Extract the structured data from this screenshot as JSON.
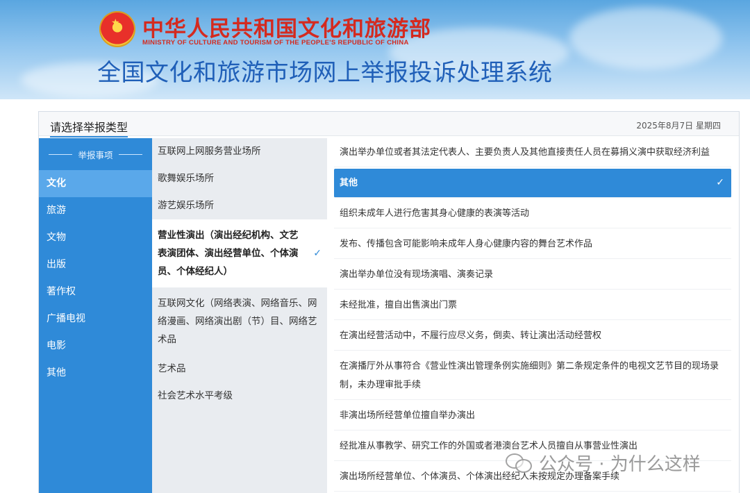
{
  "header": {
    "ministry_cn": "中华人民共和国文化和旅游部",
    "ministry_en": "MINISTRY OF CULTURE AND TOURISM OF THE PEOPLE'S REPUBLIC OF CHINA",
    "system_title": "全国文化和旅游市场网上举报投诉处理系统"
  },
  "panel": {
    "title": "请选择举报类型",
    "date": "2025年8月7日 星期四"
  },
  "sidebar": {
    "heading": "举报事项",
    "items": [
      {
        "label": "文化",
        "active": true
      },
      {
        "label": "旅游"
      },
      {
        "label": "文物"
      },
      {
        "label": "出版"
      },
      {
        "label": "著作权"
      },
      {
        "label": "广播电视"
      },
      {
        "label": "电影"
      },
      {
        "label": "其他"
      }
    ]
  },
  "middle": {
    "items": [
      {
        "label": "互联网上网服务营业场所"
      },
      {
        "label": "歌舞娱乐场所"
      },
      {
        "label": "游艺娱乐场所"
      },
      {
        "label": "营业性演出（演出经纪机构、文艺表演团体、演出经营单位、个体演员、个体经纪人）",
        "active": true
      },
      {
        "label": "互联网文化（网络表演、网络音乐、网络漫画、网络演出剧（节）目、网络艺术品"
      },
      {
        "label": "艺术品"
      },
      {
        "label": "社会艺术水平考级"
      }
    ]
  },
  "right": {
    "items": [
      {
        "label": "演出举办单位或者其法定代表人、主要负责人及其他直接责任人员在募捐义演中获取经济利益"
      },
      {
        "label": "其他",
        "active": true
      },
      {
        "label": "组织未成年人进行危害其身心健康的表演等活动"
      },
      {
        "label": "发布、传播包含可能影响未成年人身心健康内容的舞台艺术作品"
      },
      {
        "label": "演出举办单位没有现场演唱、演奏记录"
      },
      {
        "label": "未经批准，擅自出售演出门票"
      },
      {
        "label": "在演出经营活动中，不履行应尽义务，倒卖、转让演出活动经营权"
      },
      {
        "label": "在演播厅外从事符合《营业性演出管理条例实施细则》第二条规定条件的电视文艺节目的现场录制，未办理审批手续"
      },
      {
        "label": "非演出场所经营单位擅自举办演出"
      },
      {
        "label": "经批准从事教学、研究工作的外国或者港澳台艺术人员擅自从事营业性演出"
      },
      {
        "label": "演出场所经营单位、个体演员、个体演出经纪人未按规定办理备案手续"
      }
    ]
  },
  "icons": {
    "check": "✓"
  },
  "watermark": {
    "text": "公众号 · 为什么这样"
  },
  "colors": {
    "primary": "#2f8ad8",
    "active_sidebar": "#5aa8ea",
    "ministry_red": "#d42a1f",
    "title_blue": "#1f5fb8"
  }
}
